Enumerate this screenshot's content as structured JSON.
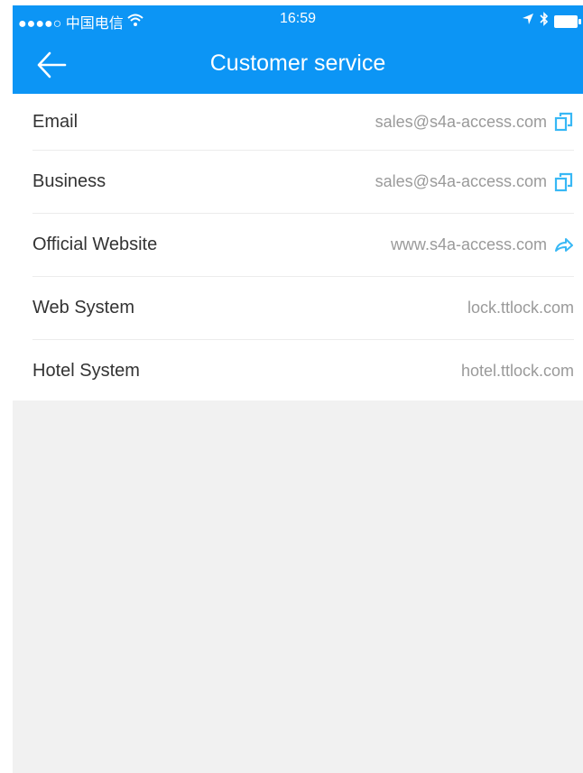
{
  "status_bar": {
    "carrier": "●●●●○ 中国电信",
    "time": "16:59"
  },
  "header": {
    "title": "Customer service"
  },
  "items": [
    {
      "label": "Email",
      "value": "sales@s4a-access.com",
      "icon": "copy-icon"
    },
    {
      "label": "Business",
      "value": "sales@s4a-access.com",
      "icon": "copy-icon"
    },
    {
      "label": "Official Website",
      "value": "www.s4a-access.com",
      "icon": "share-icon"
    },
    {
      "label": "Web System",
      "value": "lock.ttlock.com"
    },
    {
      "label": "Hotel System",
      "value": "hotel.ttlock.com"
    }
  ],
  "colors": {
    "primary": "#0c95f5",
    "background": "#f1f1f1",
    "icon_accent": "#38b8f5"
  }
}
